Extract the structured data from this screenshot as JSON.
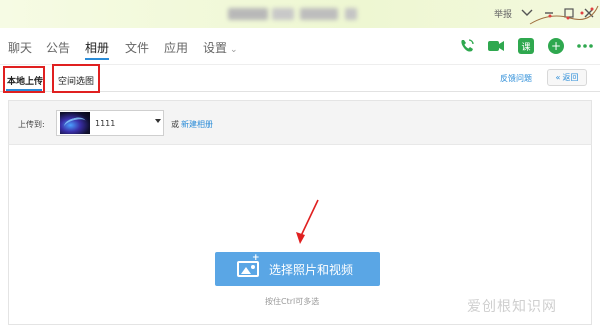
{
  "titlebar": {
    "report_label": "举报",
    "window_controls": [
      "minimize-icon",
      "maximize-icon",
      "close-icon"
    ]
  },
  "nav": {
    "tabs": [
      {
        "label": "聊天",
        "active": false
      },
      {
        "label": "公告",
        "active": false
      },
      {
        "label": "相册",
        "active": true
      },
      {
        "label": "文件",
        "active": false
      },
      {
        "label": "应用",
        "active": false
      },
      {
        "label": "设置",
        "active": false
      }
    ],
    "icons": [
      "phone-icon",
      "video-icon",
      "course-icon",
      "add-icon",
      "more-icon"
    ],
    "course_icon_text": "课",
    "colors": {
      "accent": "#2a8cd8",
      "icon_green": "#2fa84f"
    }
  },
  "subtabs": {
    "local_upload": "本地上传",
    "space_pick": "空间选图",
    "feedback": "反馈问题",
    "back": "返回"
  },
  "upload": {
    "upload_to_label": "上传到:",
    "album_name": "1111",
    "or_text": "或",
    "new_album_link": "新建相册"
  },
  "main": {
    "select_button": "选择照片和视频",
    "hint": "按住Ctrl可多选",
    "button_color": "#5aa6e5"
  },
  "watermark": "爱创根知识网",
  "annotation_color": "#e02020"
}
